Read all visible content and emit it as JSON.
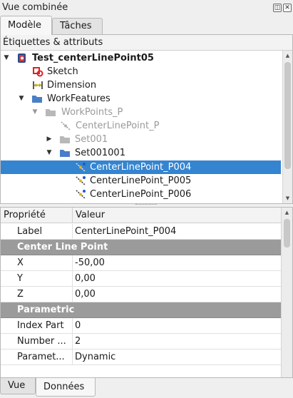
{
  "window": {
    "title": "Vue combinée",
    "float_btn": "◫",
    "close_btn": "✕"
  },
  "tabs": [
    {
      "label": "Modèle",
      "active": true
    },
    {
      "label": "Tâches",
      "active": false
    }
  ],
  "tree": {
    "header": "Étiquettes & attributs",
    "items": [
      {
        "label": "Test_centerLinePoint05",
        "icon": "document-icon",
        "bold": true
      },
      {
        "label": "Sketch",
        "icon": "sketch-icon"
      },
      {
        "label": "Dimension",
        "icon": "dimension-icon"
      },
      {
        "label": "WorkFeatures",
        "icon": "folder-icon"
      },
      {
        "label": "WorkPoints_P",
        "icon": "folder-icon",
        "dim": true
      },
      {
        "label": "CenterLinePoint_P",
        "icon": "point-icon",
        "dim": true
      },
      {
        "label": "Set001",
        "icon": "folder-icon",
        "dim": true
      },
      {
        "label": "Set001001",
        "icon": "folder-icon"
      },
      {
        "label": "CenterLinePoint_P004",
        "icon": "point-icon",
        "selected": true
      },
      {
        "label": "CenterLinePoint_P005",
        "icon": "point-icon"
      },
      {
        "label": "CenterLinePoint_P006",
        "icon": "point-icon"
      }
    ]
  },
  "properties": {
    "col_property": "Propriété",
    "col_value": "Valeur",
    "rows": [
      {
        "type": "prop",
        "key": "Label",
        "value": "CenterLinePoint_P004"
      },
      {
        "type": "group",
        "key": "Center Line Point"
      },
      {
        "type": "prop",
        "key": "X",
        "value": "-50,00"
      },
      {
        "type": "prop",
        "key": "Y",
        "value": "0,00"
      },
      {
        "type": "prop",
        "key": "Z",
        "value": "0,00"
      },
      {
        "type": "group",
        "key": "Parametric"
      },
      {
        "type": "prop",
        "key": "Index Part",
        "value": "0"
      },
      {
        "type": "prop",
        "key": "Number ...",
        "value": "2"
      },
      {
        "type": "prop",
        "key": "Paramet...",
        "value": "Dynamic"
      }
    ]
  },
  "bottom_tabs": [
    {
      "label": "Vue",
      "active": false
    },
    {
      "label": "Données",
      "active": true
    }
  ],
  "colors": {
    "selection": "#3484d0",
    "group_row": "#9b9b9b"
  }
}
